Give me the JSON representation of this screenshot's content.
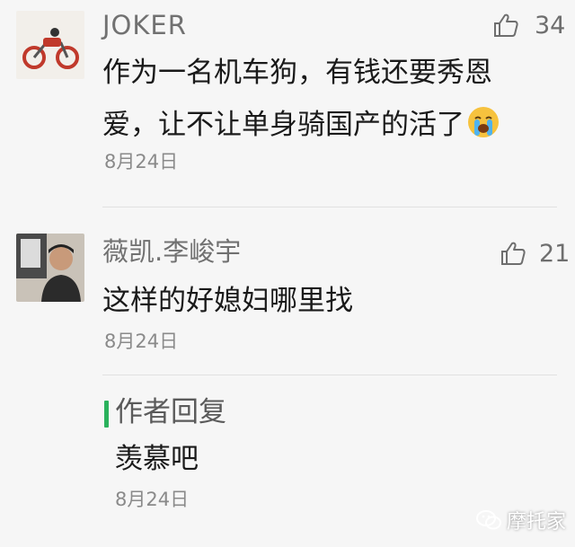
{
  "comments": [
    {
      "nickname": "JOKER",
      "likes": "34",
      "text_line1": "作为一名机车狗，有钱还要秀恩",
      "text_line2": "爱，让不让单身骑国产的活了",
      "emoji": "crying-face-icon",
      "date": "8月24日"
    },
    {
      "nickname": "薇凯.李峻宇",
      "likes": "21",
      "text": "这样的好媳妇哪里找",
      "date": "8月24日"
    }
  ],
  "author_reply": {
    "label": "作者回复",
    "text": "羡慕吧",
    "date": "8月24日",
    "accent_color": "#2ab25c"
  },
  "watermark": {
    "text": "摩托家",
    "icon": "wechat-logo-icon"
  }
}
